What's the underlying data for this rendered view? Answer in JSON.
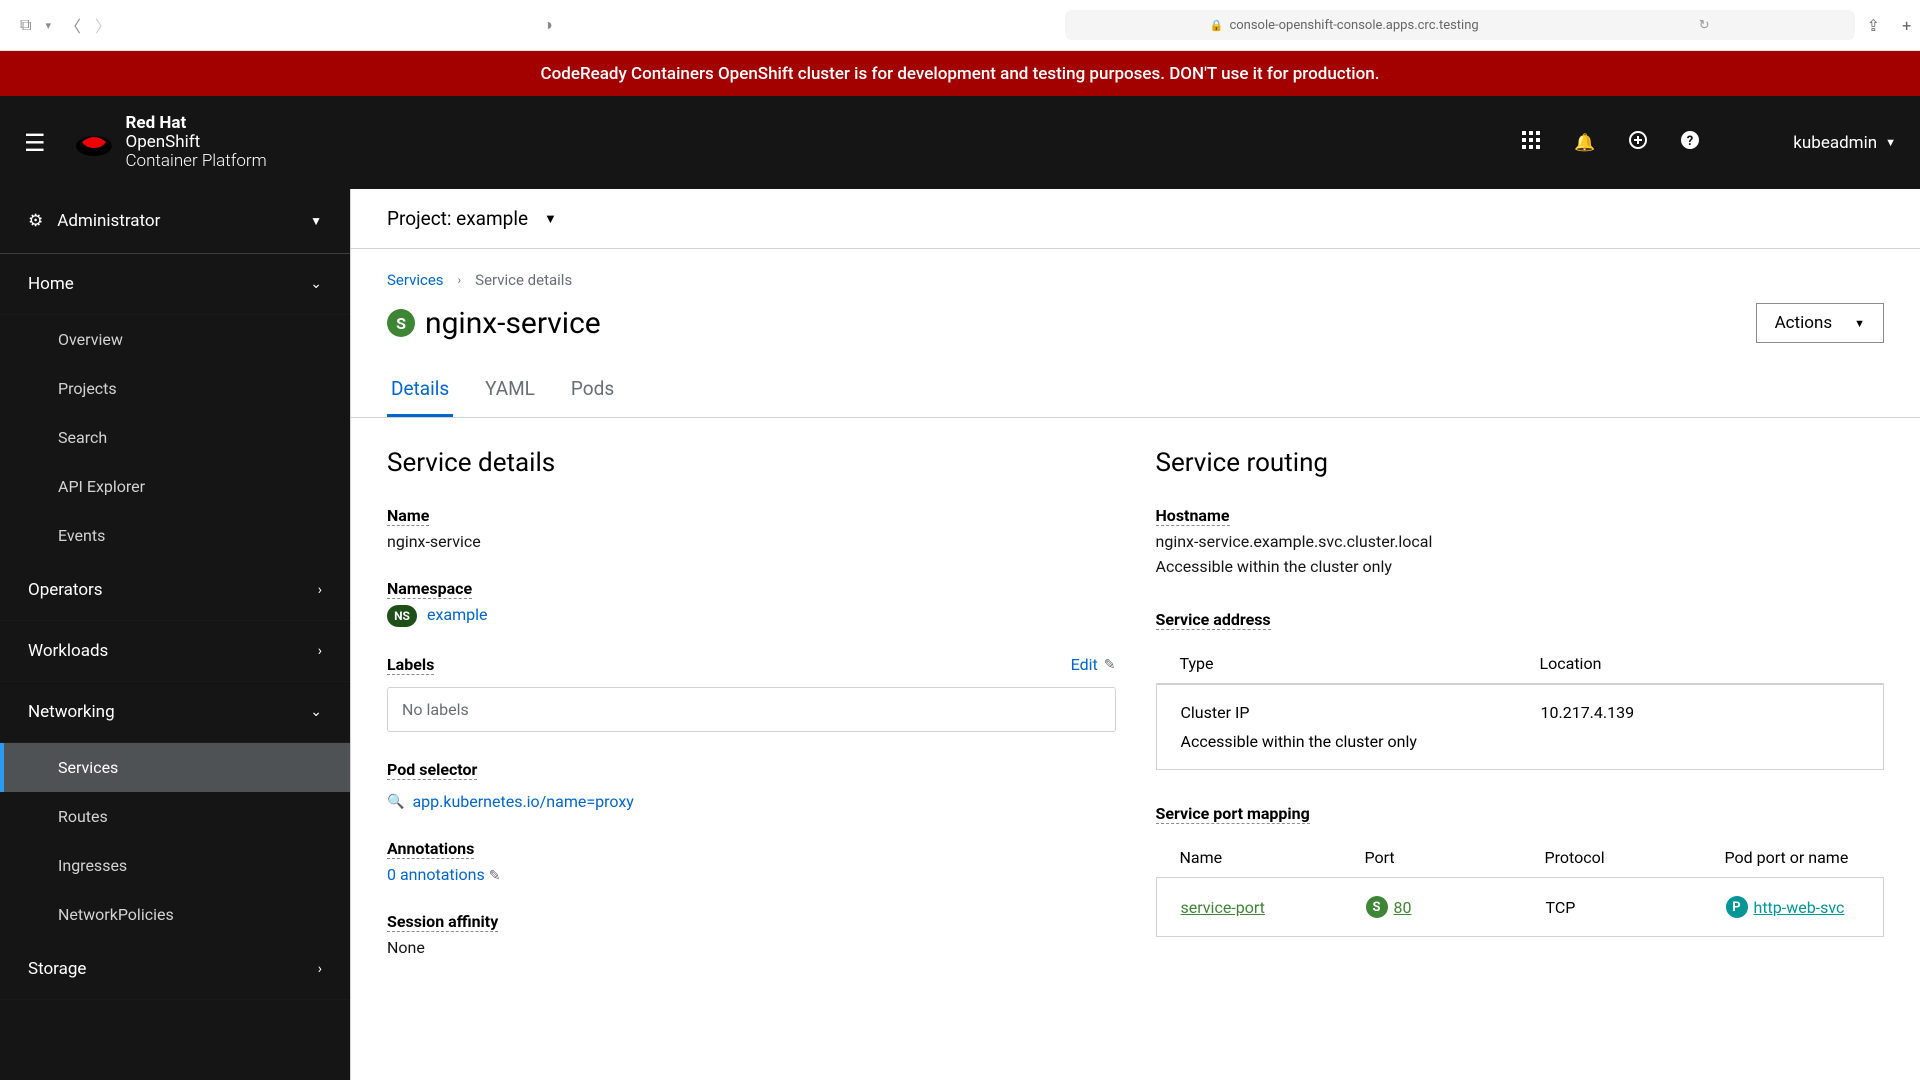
{
  "browser": {
    "url": "console-openshift-console.apps.crc.testing"
  },
  "banner": {
    "text": "CodeReady Containers OpenShift cluster is for development and testing purposes. DON'T use it for production."
  },
  "masthead": {
    "brand_l1": "Red Hat",
    "brand_l2": "OpenShift",
    "brand_l3": "Container Platform",
    "user": "kubeadmin"
  },
  "sidebar": {
    "perspective": "Administrator",
    "sections": [
      {
        "label": "Home",
        "expanded": true,
        "items": [
          "Overview",
          "Projects",
          "Search",
          "API Explorer",
          "Events"
        ]
      },
      {
        "label": "Operators",
        "expanded": false
      },
      {
        "label": "Workloads",
        "expanded": false
      },
      {
        "label": "Networking",
        "expanded": true,
        "items": [
          "Services",
          "Routes",
          "Ingresses",
          "NetworkPolicies"
        ],
        "active": "Services"
      },
      {
        "label": "Storage",
        "expanded": false
      }
    ]
  },
  "project": {
    "label": "Project: example"
  },
  "breadcrumb": {
    "root": "Services",
    "current": "Service details"
  },
  "title": {
    "badge": "S",
    "name": "nginx-service"
  },
  "actions_label": "Actions",
  "tabs": [
    "Details",
    "YAML",
    "Pods"
  ],
  "details_heading": "Service details",
  "details": {
    "name_dt": "Name",
    "name": "nginx-service",
    "namespace_dt": "Namespace",
    "namespace_badge": "NS",
    "namespace": "example",
    "labels_dt": "Labels",
    "labels_edit": "Edit",
    "labels_none": "No labels",
    "podsel_dt": "Pod selector",
    "podsel": "app.kubernetes.io/name=proxy",
    "anno_dt": "Annotations",
    "anno": "0 annotations",
    "session_dt": "Session affinity",
    "session": "None"
  },
  "routing_heading": "Service routing",
  "routing": {
    "hostname_dt": "Hostname",
    "hostname": "nginx-service.example.svc.cluster.local",
    "hostname_note": "Accessible within the cluster only",
    "address_dt": "Service address",
    "addr_h1": "Type",
    "addr_h2": "Location",
    "addr_type": "Cluster IP",
    "addr_loc": "10.217.4.139",
    "addr_note": "Accessible within the cluster only",
    "port_dt": "Service port mapping",
    "port_h1": "Name",
    "port_h2": "Port",
    "port_h3": "Protocol",
    "port_h4": "Pod port or name",
    "port_name": "service-port",
    "port_badge": "S",
    "port_num": "80",
    "port_proto": "TCP",
    "podport_badge": "P",
    "podport": "http-web-svc"
  }
}
